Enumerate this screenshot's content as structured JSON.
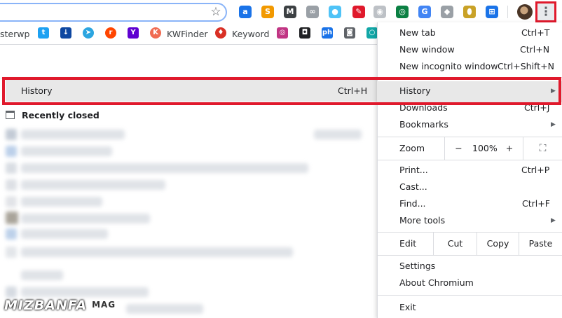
{
  "toolbar": {
    "extensions": [
      {
        "name": "adblock-icon",
        "color": "#1a73e8",
        "glyph": "a"
      },
      {
        "name": "ext-orange-icon",
        "color": "#f29900",
        "glyph": "S"
      },
      {
        "name": "ext-m-icon",
        "color": "#3c4043",
        "glyph": "M"
      },
      {
        "name": "ext-bike-icon",
        "color": "#9aa0a6",
        "glyph": "∞"
      },
      {
        "name": "ext-drop-icon",
        "color": "#4fc3f7",
        "glyph": "●"
      },
      {
        "name": "ext-pipette-icon",
        "color": "#e0192c",
        "glyph": "✎"
      },
      {
        "name": "ext-pin-icon",
        "color": "#bdc1c6",
        "glyph": "◉"
      },
      {
        "name": "ext-circle-icon",
        "color": "#0b8043",
        "glyph": "◎"
      },
      {
        "name": "translate-icon",
        "color": "#4285f4",
        "glyph": "G"
      },
      {
        "name": "ext-diamond-icon",
        "color": "#9aa0a6",
        "glyph": "◆"
      },
      {
        "name": "ext-shield-icon",
        "color": "#c9a227",
        "glyph": "⬮"
      },
      {
        "name": "ext-window-icon",
        "color": "#1a73e8",
        "glyph": "⊞"
      }
    ]
  },
  "bookmarks": {
    "item_1": "sterwp",
    "item_2": "KWFinder",
    "item_3": "Keyword"
  },
  "submenu": {
    "history_label": "History",
    "history_shortcut": "Ctrl+H",
    "recently_closed": "Recently closed"
  },
  "menu": {
    "new_tab": "New tab",
    "new_tab_sc": "Ctrl+T",
    "new_window": "New window",
    "new_window_sc": "Ctrl+N",
    "incognito": "New incognito window",
    "incognito_sc": "Ctrl+Shift+N",
    "history": "History",
    "downloads": "Downloads",
    "downloads_sc": "Ctrl+J",
    "bookmarks": "Bookmarks",
    "zoom": "Zoom",
    "zoom_minus": "−",
    "zoom_level": "100%",
    "zoom_plus": "+",
    "print": "Print...",
    "print_sc": "Ctrl+P",
    "cast": "Cast...",
    "find": "Find...",
    "find_sc": "Ctrl+F",
    "more_tools": "More tools",
    "edit": "Edit",
    "cut": "Cut",
    "copy": "Copy",
    "paste": "Paste",
    "settings": "Settings",
    "about": "About Chromium",
    "exit": "Exit"
  },
  "watermark": {
    "brand": "MIZBANFA",
    "suffix": "MAG"
  },
  "colors": {
    "highlight": "#e0192c",
    "hover": "#e8e8e8"
  }
}
